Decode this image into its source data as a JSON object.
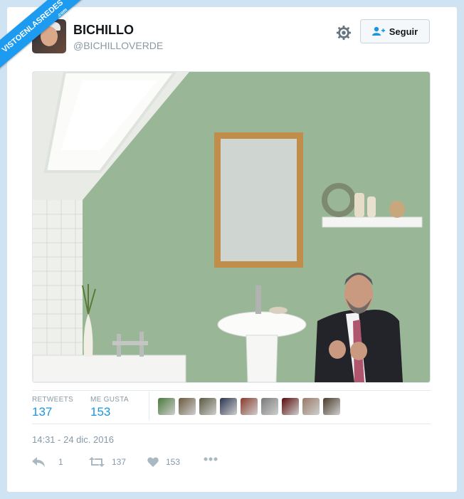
{
  "watermark": {
    "text": "VISTOENLASREDES",
    "sub": ".com"
  },
  "user": {
    "name": "BICHILLO",
    "handle": "@BICHILLOVERDE"
  },
  "follow": {
    "label": "Seguir"
  },
  "stats": {
    "retweets_label": "RETWEETS",
    "retweets_value": "137",
    "likes_label": "ME GUSTA",
    "likes_value": "153"
  },
  "liker_colors": [
    "#4a7a3a",
    "#6b5a3e",
    "#5a5a42",
    "#2a3550",
    "#8a3a2a",
    "#7a7a7a",
    "#5a0a0a",
    "#9a7a66",
    "#4a3a2a"
  ],
  "timestamp": "14:31 - 24 dic. 2016",
  "actions": {
    "reply_count": "1",
    "retweet_count": "137",
    "like_count": "153"
  },
  "colors": {
    "accent": "#1b95e0",
    "muted": "#8899a6",
    "wall": "#9fbc9c"
  }
}
